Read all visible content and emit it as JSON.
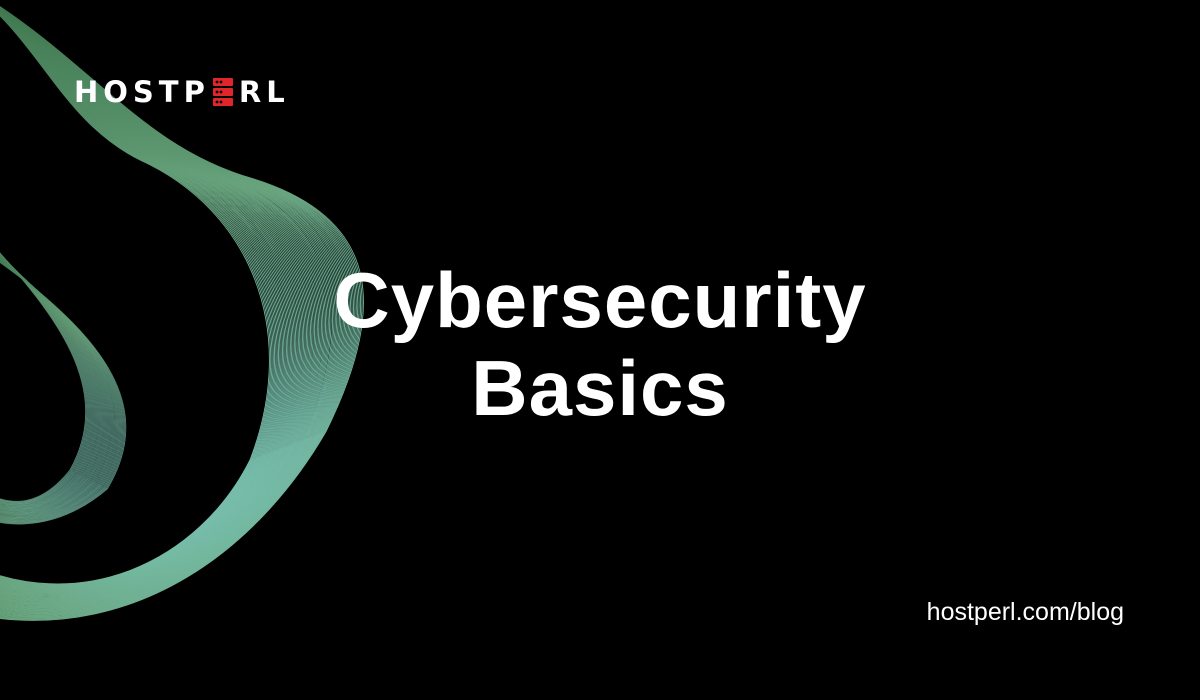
{
  "brand": {
    "logo_text_left": "HOSTP",
    "logo_text_right": "RL",
    "logo_icon": "server-rack-icon",
    "logo_icon_color": "#e0262b"
  },
  "headline": {
    "line1": "Cybersecurity",
    "line2": "Basics"
  },
  "footer": {
    "url": "hostperl.com/blog"
  },
  "colors": {
    "background": "#000000",
    "text": "#ffffff",
    "wave_start": "#3f7a4f",
    "wave_end": "#7fd0c6"
  }
}
